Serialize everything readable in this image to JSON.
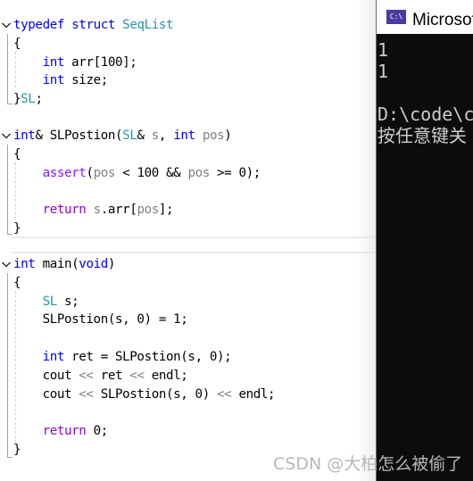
{
  "editor": {
    "blocks": [
      {
        "name": "struct-seqlist",
        "lines": [
          [
            {
              "t": "typedef",
              "c": "kw"
            },
            {
              "t": " ",
              "c": ""
            },
            {
              "t": "struct",
              "c": "kw"
            },
            {
              "t": " ",
              "c": ""
            },
            {
              "t": "SeqList",
              "c": "type"
            }
          ],
          [
            {
              "t": "{",
              "c": "brace"
            }
          ],
          [
            {
              "t": "    ",
              "c": ""
            },
            {
              "t": "int",
              "c": "kw"
            },
            {
              "t": " arr[100];",
              "c": ""
            }
          ],
          [
            {
              "t": "    ",
              "c": ""
            },
            {
              "t": "int",
              "c": "kw"
            },
            {
              "t": " size;",
              "c": ""
            }
          ],
          [
            {
              "t": "}",
              "c": "brace"
            },
            {
              "t": "SL",
              "c": "type"
            },
            {
              "t": ";",
              "c": ""
            }
          ]
        ]
      },
      {
        "name": "function-slpostion",
        "lines": [
          [
            {
              "t": "int",
              "c": "kw"
            },
            {
              "t": "& ",
              "c": ""
            },
            {
              "t": "SLPostion",
              "c": "func"
            },
            {
              "t": "(",
              "c": ""
            },
            {
              "t": "SL",
              "c": "type"
            },
            {
              "t": "& ",
              "c": ""
            },
            {
              "t": "s",
              "c": "param"
            },
            {
              "t": ", ",
              "c": ""
            },
            {
              "t": "int",
              "c": "kw"
            },
            {
              "t": " ",
              "c": ""
            },
            {
              "t": "pos",
              "c": "param"
            },
            {
              "t": ")",
              "c": ""
            }
          ],
          [
            {
              "t": "{",
              "c": "brace"
            }
          ],
          [
            {
              "t": "    ",
              "c": ""
            },
            {
              "t": "assert",
              "c": "macro"
            },
            {
              "t": "(",
              "c": ""
            },
            {
              "t": "pos",
              "c": "param"
            },
            {
              "t": " < 100 && ",
              "c": ""
            },
            {
              "t": "pos",
              "c": "param"
            },
            {
              "t": " >= 0);",
              "c": ""
            }
          ],
          [
            {
              "t": "",
              "c": ""
            }
          ],
          [
            {
              "t": "    ",
              "c": ""
            },
            {
              "t": "return",
              "c": "ctrl"
            },
            {
              "t": " ",
              "c": ""
            },
            {
              "t": "s",
              "c": "param"
            },
            {
              "t": ".arr[",
              "c": ""
            },
            {
              "t": "pos",
              "c": "param"
            },
            {
              "t": "];",
              "c": ""
            }
          ],
          [
            {
              "t": "}",
              "c": "brace"
            }
          ]
        ]
      },
      {
        "name": "function-main",
        "lines": [
          [
            {
              "t": "int",
              "c": "kw"
            },
            {
              "t": " main(",
              "c": ""
            },
            {
              "t": "void",
              "c": "kw"
            },
            {
              "t": ")",
              "c": ""
            }
          ],
          [
            {
              "t": "{",
              "c": "brace"
            }
          ],
          [
            {
              "t": "    ",
              "c": ""
            },
            {
              "t": "SL",
              "c": "type"
            },
            {
              "t": " s;",
              "c": ""
            }
          ],
          [
            {
              "t": "    SLPostion(s, 0) = 1;",
              "c": ""
            }
          ],
          [
            {
              "t": "",
              "c": ""
            }
          ],
          [
            {
              "t": "    ",
              "c": ""
            },
            {
              "t": "int",
              "c": "kw"
            },
            {
              "t": " ret = SLPostion(s, 0);",
              "c": ""
            }
          ],
          [
            {
              "t": "    cout ",
              "c": ""
            },
            {
              "t": "<<",
              "c": "param"
            },
            {
              "t": " ret ",
              "c": ""
            },
            {
              "t": "<<",
              "c": "param"
            },
            {
              "t": " endl;",
              "c": ""
            }
          ],
          [
            {
              "t": "    cout ",
              "c": ""
            },
            {
              "t": "<<",
              "c": "param"
            },
            {
              "t": " SLPostion(s, 0) ",
              "c": ""
            },
            {
              "t": "<<",
              "c": "param"
            },
            {
              "t": " endl;",
              "c": ""
            }
          ],
          [
            {
              "t": "",
              "c": ""
            }
          ],
          [
            {
              "t": "    ",
              "c": ""
            },
            {
              "t": "return",
              "c": "ctrl"
            },
            {
              "t": " 0;",
              "c": ""
            }
          ],
          [
            {
              "t": "}",
              "c": "brace"
            }
          ]
        ]
      }
    ]
  },
  "console": {
    "icon_label": "C:\\",
    "title": "Microsoft Visual Studio 调试控制台",
    "output_lines": [
      "1",
      "1",
      "",
      "D:\\code\\c",
      "按任意键关"
    ]
  },
  "colors": {
    "keyword": "#0000ff",
    "type": "#2b91af",
    "macro": "#8a1bff",
    "control": "#8f08c4",
    "param": "#808080",
    "console_bg": "#0c0c0c",
    "console_fg": "#cccccc"
  },
  "watermark": "CSDN @大柏怎么被偷了"
}
